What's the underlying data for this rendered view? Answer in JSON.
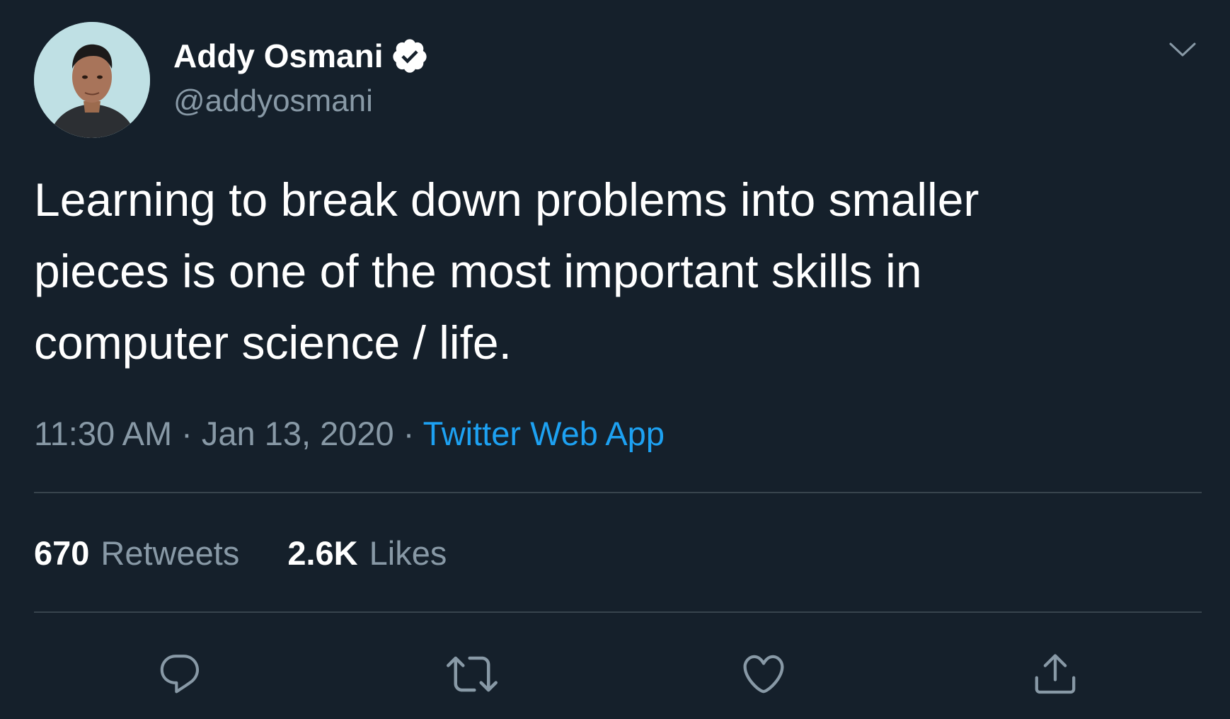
{
  "author": {
    "name": "Addy Osmani",
    "handle": "@addyosmani",
    "verified": true
  },
  "tweet": {
    "text_lines": [
      "Learning to break down problems into smaller",
      "pieces is one of the most important skills in",
      "computer science / life."
    ],
    "time": "11:30 AM",
    "separator": "·",
    "date": "Jan 13, 2020",
    "source": "Twitter Web App"
  },
  "stats": {
    "retweets_count": "670",
    "retweets_label": "Retweets",
    "likes_count": "2.6K",
    "likes_label": "Likes"
  },
  "actions": [
    "reply-icon",
    "retweet-icon",
    "like-icon",
    "share-icon"
  ],
  "colors": {
    "background": "#15202b",
    "text_primary": "#ffffff",
    "text_secondary": "#8899a6",
    "link": "#1da1f2",
    "divider": "#38444d"
  }
}
